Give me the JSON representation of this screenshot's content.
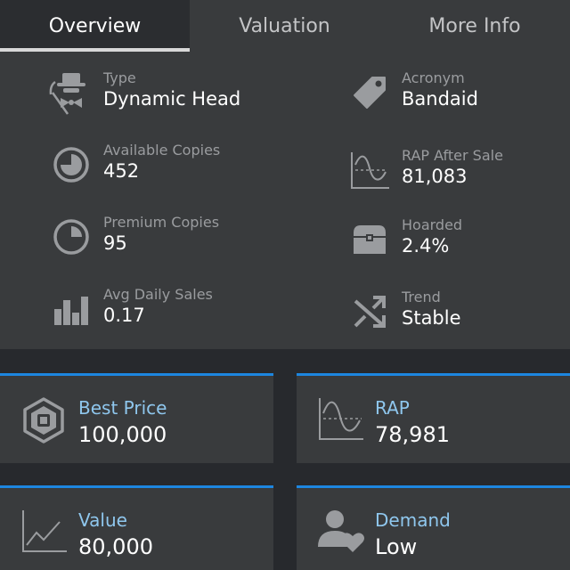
{
  "tabs": [
    {
      "label": "Overview",
      "active": true
    },
    {
      "label": "Valuation",
      "active": false
    },
    {
      "label": "More Info",
      "active": false
    }
  ],
  "overview": {
    "type": {
      "label": "Type",
      "value": "Dynamic Head",
      "icon": "hat-disguise-icon"
    },
    "acronym": {
      "label": "Acronym",
      "value": "Bandaid",
      "icon": "tag-icon"
    },
    "available_copies": {
      "label": "Available Copies",
      "value": "452",
      "icon": "pie-chart-icon"
    },
    "rap_after_sale": {
      "label": "RAP After Sale",
      "value": "81,083",
      "icon": "wave-chart-icon"
    },
    "premium_copies": {
      "label": "Premium Copies",
      "value": "95",
      "icon": "quarter-pie-icon"
    },
    "hoarded": {
      "label": "Hoarded",
      "value": "2.4%",
      "icon": "treasure-chest-icon"
    },
    "avg_daily_sales": {
      "label": "Avg Daily Sales",
      "value": "0.17",
      "icon": "bar-chart-icon"
    },
    "trend": {
      "label": "Trend",
      "value": "Stable",
      "icon": "shuffle-icon"
    }
  },
  "cards": {
    "best_price": {
      "label": "Best Price",
      "value": "100,000",
      "icon": "robux-icon"
    },
    "rap": {
      "label": "RAP",
      "value": "78,981",
      "icon": "wave-chart-icon"
    },
    "value": {
      "label": "Value",
      "value": "80,000",
      "icon": "line-chart-icon"
    },
    "demand": {
      "label": "Demand",
      "value": "Low",
      "icon": "user-heart-icon"
    }
  },
  "colors": {
    "background": "#27292d",
    "panel": "#393b3d",
    "accent_bar": "#1d86e0",
    "card_label": "#8fc7ee",
    "muted_label": "#9a9c9f"
  }
}
